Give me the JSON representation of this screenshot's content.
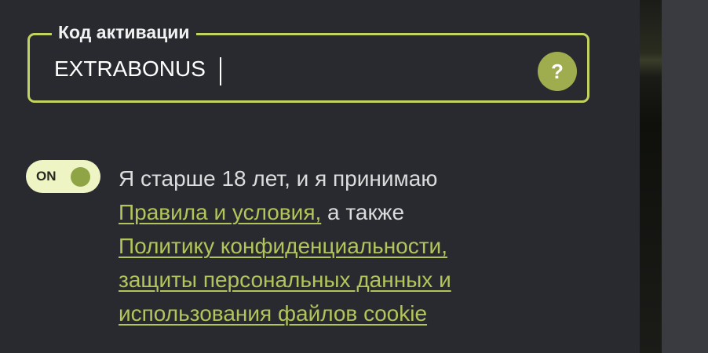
{
  "activation": {
    "label": "Код активации",
    "value": "EXTRABONUS",
    "help_symbol": "?"
  },
  "consent": {
    "toggle_label": "ON",
    "text_before": "Я старше 18 лет, и я принимаю",
    "rules_link": "Правила и условия,",
    "text_middle": " а также",
    "privacy_line1": "Политику конфиденциальности,",
    "privacy_line2": "защиты персональных данных и",
    "privacy_line3": "использования файлов cookie"
  },
  "colors": {
    "accent": "#c2d45f",
    "link": "#b2c45a",
    "background": "#292a2f"
  }
}
